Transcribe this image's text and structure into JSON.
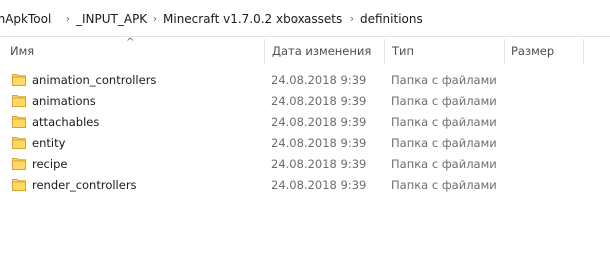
{
  "breadcrumb": [
    "chApkTool",
    "_INPUT_APK",
    "Minecraft v1.7.0.2 xbox",
    "assets",
    "definitions"
  ],
  "columns": {
    "name": "Имя",
    "date": "Дата изменения",
    "type": "Тип",
    "size": "Размер"
  },
  "files": [
    {
      "name": "animation_controllers",
      "date": "24.08.2018 9:39",
      "type": "Папка с файлами"
    },
    {
      "name": "animations",
      "date": "24.08.2018 9:39",
      "type": "Папка с файлами"
    },
    {
      "name": "attachables",
      "date": "24.08.2018 9:39",
      "type": "Папка с файлами"
    },
    {
      "name": "entity",
      "date": "24.08.2018 9:39",
      "type": "Папка с файлами"
    },
    {
      "name": "recipe",
      "date": "24.08.2018 9:39",
      "type": "Папка с файлами"
    },
    {
      "name": "render_controllers",
      "date": "24.08.2018 9:39",
      "type": "Папка с файлами"
    }
  ],
  "icons": {
    "folder": "folder-icon",
    "separator": "chevron-right-icon",
    "sort": "sort-ascending-icon"
  },
  "colors": {
    "folder": "#f0c14b",
    "folder_dark": "#d9a52c"
  }
}
